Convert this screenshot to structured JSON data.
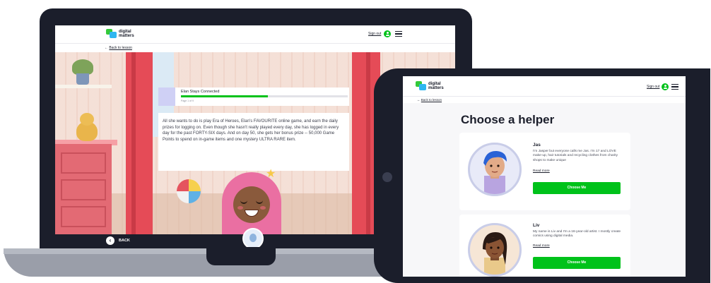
{
  "brand": {
    "logo_line1": "digital",
    "logo_line2": "matters"
  },
  "laptop": {
    "header": {
      "signout_label": "Sign out",
      "user_icon": "user-circle-icon",
      "menu_icon": "hamburger-icon"
    },
    "back_to_lesson": {
      "arrow": "←",
      "label": "Back to lesson"
    },
    "progress": {
      "title": "Elan Stays Connected",
      "meta": "Page 1 of 9",
      "fraction": 0.52
    },
    "story_text": "All she wants to do is play Era of Heroes, Elan's FAVOURITE online game, and earn the daily prizes for logging on. Even though she hasn't really played every day, she has logged in every day for the past FORTY-SIX days. And on day 50, she gets her bonus prize -- 50,000 Game Points to spend on in-game items and one mystery ULTRA RARE item.",
    "footer": {
      "back_icon": "‹",
      "back_label": "BACK"
    }
  },
  "tablet": {
    "header": {
      "signout_label": "Sign out"
    },
    "back_to_lesson": {
      "arrow": "←",
      "label": "Back to lesson"
    },
    "page_title": "Choose a helper",
    "helpers": [
      {
        "name": "Jas",
        "description": "I'm Jasper but everyone calls me Jas. I'm 17 and LOVE make-up, hair tutorials and recycling clothes from charity shops to make unique",
        "read_more": "Read more",
        "button": "Choose Me"
      },
      {
        "name": "Liv",
        "description": "My name is Liv and I'm a 16-year-old artist. I mostly create comics using digital media.",
        "read_more": "Read more",
        "button": "Choose Me"
      }
    ]
  },
  "colors": {
    "accent_green": "#00c21a",
    "dark_navy": "#1b1e2b",
    "logo_blue": "#2fb6f0"
  }
}
